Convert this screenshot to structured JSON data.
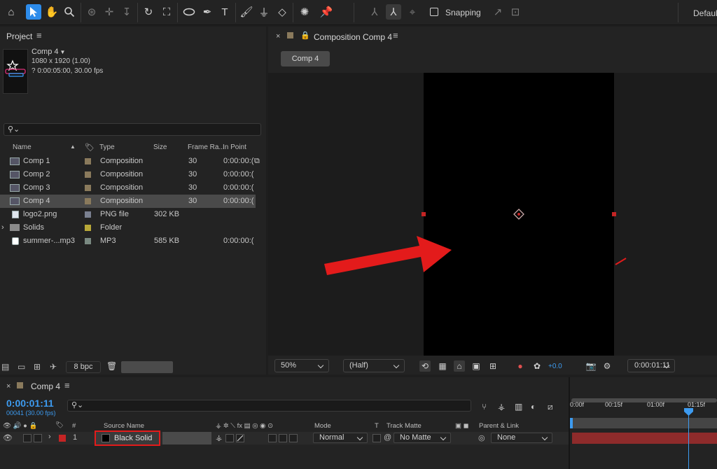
{
  "toolbar": {
    "tools": [
      "home-icon",
      "selection-tool",
      "hand-tool",
      "zoom-tool",
      "orbit-camera-tool",
      "pan-camera-tool",
      "dolly-camera-tool",
      "rotation-tool",
      "pan-behind-tool",
      "ellipse-tool",
      "pen-tool",
      "type-tool",
      "brush-tool",
      "clone-stamp-tool",
      "eraser-tool",
      "roto-brush-tool",
      "puppet-pin-tool"
    ],
    "snapping_label": "Snapping",
    "workspace_label": "Defaul"
  },
  "project": {
    "panel_title": "Project",
    "comp_name": "Comp 4",
    "comp_dims": "1080 x 1920 (1.00)",
    "comp_duration": "? 0:00:05:00, 30.00 fps",
    "columns": {
      "name": "Name",
      "type": "Type",
      "size": "Size",
      "frame_rate": "Frame Ra...",
      "in_point": "In Point"
    },
    "items": [
      {
        "name": "Comp 1",
        "type": "Composition",
        "size": "",
        "frame_rate": "30",
        "in_point": "0:00:00:(",
        "color": "#8a7a5c",
        "selected": false,
        "kind": "comp"
      },
      {
        "name": "Comp 2",
        "type": "Composition",
        "size": "",
        "frame_rate": "30",
        "in_point": "0:00:00:(",
        "color": "#8a7a5c",
        "selected": false,
        "kind": "comp"
      },
      {
        "name": "Comp 3",
        "type": "Composition",
        "size": "",
        "frame_rate": "30",
        "in_point": "0:00:00:(",
        "color": "#8a7a5c",
        "selected": false,
        "kind": "comp"
      },
      {
        "name": "Comp 4",
        "type": "Composition",
        "size": "",
        "frame_rate": "30",
        "in_point": "0:00:00:(",
        "color": "#8a7a5c",
        "selected": true,
        "kind": "comp"
      },
      {
        "name": "logo2.png",
        "type": "PNG file",
        "size": "302 KB",
        "frame_rate": "",
        "in_point": "",
        "color": "#7a8090",
        "selected": false,
        "kind": "png"
      },
      {
        "name": "Solids",
        "type": "Folder",
        "size": "",
        "frame_rate": "",
        "in_point": "",
        "color": "#b8a838",
        "selected": false,
        "kind": "folder"
      },
      {
        "name": "summer-...mp3",
        "type": "MP3",
        "size": "585 KB",
        "frame_rate": "",
        "in_point": "0:00:00:(",
        "color": "#7a8a82",
        "selected": false,
        "kind": "audio"
      }
    ],
    "bpc": "8 bpc"
  },
  "composition": {
    "tab_label": "Composition Comp 4",
    "comp_button": "Comp 4",
    "zoom": "50%",
    "resolution": "(Half)",
    "exposure": "+0.0",
    "current_time": "0:00:01:11"
  },
  "timeline": {
    "tab_label": "Comp 4",
    "timecode": "0:00:01:11",
    "frames_fps": "00041 (30.00 fps)",
    "columns": {
      "num": "#",
      "source_name": "Source Name",
      "mode": "Mode",
      "t": "T",
      "track_matte": "Track Matte",
      "parent_link": "Parent & Link"
    },
    "ruler": [
      "0:00f",
      "00:15f",
      "01:00f",
      "01:15f"
    ],
    "layers": [
      {
        "index": "1",
        "name": "Black Solid",
        "mode": "Normal",
        "track_matte": "No Matte",
        "parent": "None",
        "label_color": "#c42424"
      }
    ]
  },
  "colors": {
    "accent": "#2d8ceb",
    "timecode_blue": "#3d9bf0",
    "highlight_red": "#e31b1b"
  }
}
